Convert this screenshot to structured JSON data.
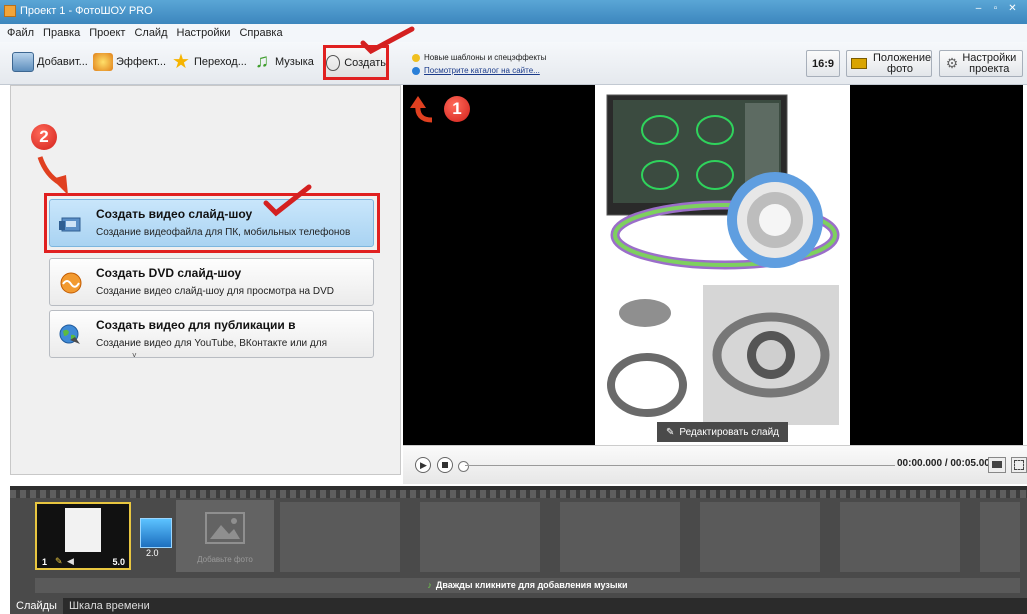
{
  "window": {
    "title": "Проект 1 - ФотоШОУ PRO",
    "controls": [
      "–",
      "▫",
      "✕"
    ]
  },
  "menu": [
    "Файл",
    "Правка",
    "Проект",
    "Слайд",
    "Настройки",
    "Справка"
  ],
  "toolbar": {
    "add": "Добавит...",
    "effects": "Эффект...",
    "transitions": "Переход...",
    "music": "Музыка",
    "create": "Создать",
    "news_line1": "Новые шаблоны и спецэффекты",
    "news_line2": "Посмотрите каталог на сайте...",
    "aspect": "16:9",
    "photo_position": "Положение фото",
    "project_settings": "Настройки проекта"
  },
  "annotations": {
    "step1": "1",
    "step2": "2"
  },
  "create_options": [
    {
      "title": "Создать видео слайд-шоу",
      "desc": "Создание видеофайла для ПК, мобильных телефонов",
      "icon": "film-icon"
    },
    {
      "title": "Создать DVD слайд-шоу",
      "desc": "Создание видео слайд-шоу для просмотра на DVD",
      "icon": "dvd-icon"
    },
    {
      "title": "Создать видео для публикации в",
      "desc": "Создание видео для YouTube, ВКонтакте или для",
      "icon": "globe-icon"
    }
  ],
  "preview": {
    "edit_slide": "Редактировать слайд"
  },
  "player": {
    "time": "00:00.000 / 00:05.000"
  },
  "timeline": {
    "slide_number": "1",
    "slide_duration": "5.0",
    "transition_duration": "2.0",
    "add_photo": "Добавьте фото",
    "music_hint": "Дважды кликните для добавления музыки"
  },
  "tabs": [
    "Слайды",
    "Шкала времени"
  ],
  "colors": {
    "accent_red": "#e02020",
    "selected_card": "#b9dcf7",
    "title_bar": "#4a95ca"
  }
}
